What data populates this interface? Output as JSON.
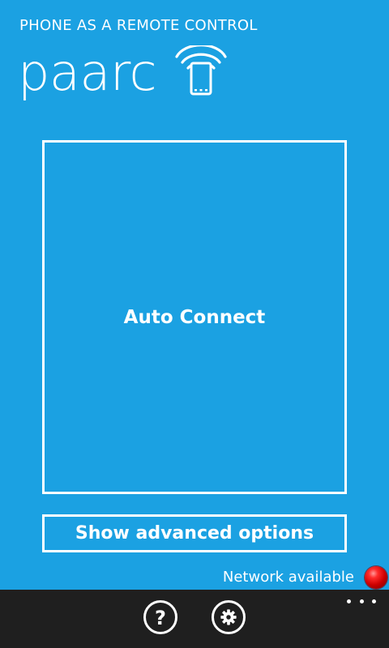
{
  "header": {
    "subtitle": "PHONE AS A REMOTE CONTROL",
    "app_name": "paarc",
    "logo_icon": "phone-signal-icon"
  },
  "main": {
    "auto_connect_label": "Auto Connect",
    "advanced_options_label": "Show advanced options"
  },
  "status": {
    "text": "Network available",
    "indicator_color": "#e00000"
  },
  "app_bar": {
    "buttons": [
      {
        "icon": "help-icon",
        "glyph": "?"
      },
      {
        "icon": "gear-icon"
      }
    ],
    "more_icon": "ellipsis-icon"
  },
  "colors": {
    "accent_background": "#1ba1e2",
    "app_bar_background": "#1f1f1f",
    "foreground": "#ffffff"
  }
}
